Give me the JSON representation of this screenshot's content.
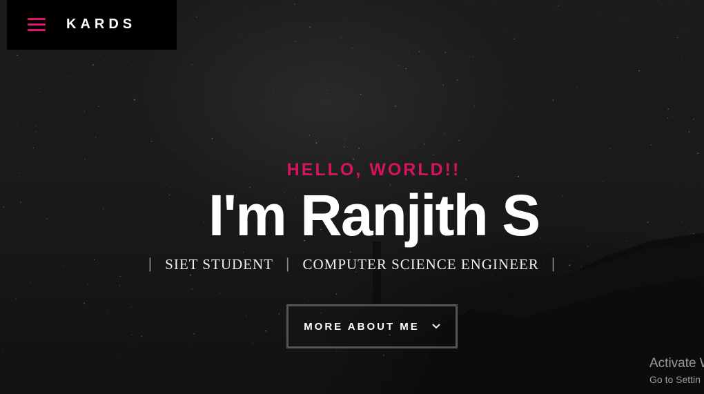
{
  "header": {
    "menu_icon": "hamburger-menu-icon",
    "logo_text": "KARDS",
    "accent_color": "#e0146d"
  },
  "hero": {
    "kicker": "HELLO, WORLD!!",
    "title": "I'm Ranjith S",
    "roles": [
      "SIET STUDENT",
      "COMPUTER SCIENCE ENGINEER"
    ],
    "separator": "|",
    "cta_label": "MORE ABOUT ME",
    "cta_icon": "chevron-down-icon",
    "kicker_color": "#d5145e"
  },
  "watermark": {
    "line1": "Activate W",
    "line2": "Go to Settin"
  }
}
